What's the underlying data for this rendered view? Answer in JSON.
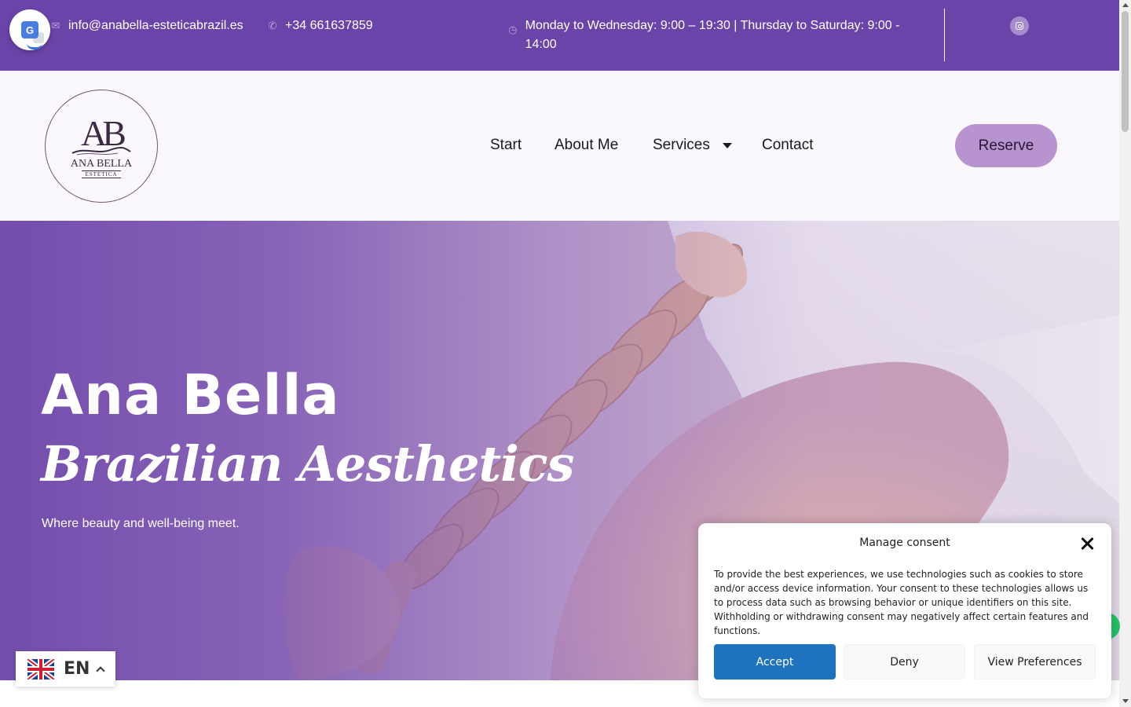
{
  "topbar": {
    "email": "info@anabella-esteticabrazil.es",
    "phone": "+34 661637859",
    "hours": "Monday to Wednesday: 9:00 – 19:30 | Thursday to Saturday: 9:00 - 14:00",
    "icons": {
      "email": "envelope-icon",
      "phone": "whatsapp-icon",
      "hours": "clock-icon",
      "social": "instagram-icon"
    }
  },
  "logo": {
    "monogram": "AB",
    "name": "ANA BELLA",
    "sub": "ESTÉTICA"
  },
  "nav": {
    "items": [
      "Start",
      "About Me",
      "Services",
      "Contact"
    ],
    "reserve": "Reserve"
  },
  "hero": {
    "title": "Ana Bella",
    "subtitle": "Brazilian Aesthetics",
    "tagline": "Where beauty and well-being meet."
  },
  "consent": {
    "title": "Manage consent",
    "body": "To provide the best experiences, we use technologies such as cookies to store and/or access device information. Your consent to these technologies allows us to process data such as browsing behavior or unique identifiers on this site. Withholding or withdrawing consent may negatively affect certain features and functions.",
    "accept": "Accept",
    "deny": "Deny",
    "preferences": "View Preferences"
  },
  "language": {
    "code": "EN",
    "flag": "uk-flag-icon"
  },
  "colors": {
    "brand": "#6a44a8",
    "reserve": "#b793cf",
    "accept": "#1e73be",
    "header_bg": "#fbf8fd"
  }
}
